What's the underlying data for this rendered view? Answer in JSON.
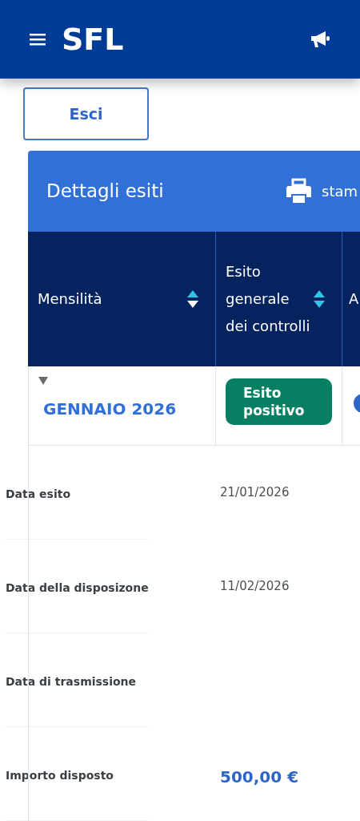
{
  "header": {
    "logo": "SFL"
  },
  "exit_button": "Esci",
  "card": {
    "title": "Dettagli esiti",
    "print_label": "stam"
  },
  "table": {
    "columns": [
      {
        "label": "Mensilità",
        "sorted": true
      },
      {
        "label": "Esito generale dei controlli",
        "sorted": false
      },
      {
        "label": "A"
      }
    ],
    "rows": [
      {
        "month": "GENNAIO 2026",
        "expanded": true,
        "status": {
          "label": "Esito positivo",
          "color": "#087f62"
        }
      }
    ]
  },
  "details": [
    {
      "label": "Data esito",
      "kind": "date",
      "value": "21/01/2026"
    },
    {
      "label": "Data della disposizone",
      "kind": "date",
      "value": "11/02/2026"
    },
    {
      "label": "Data di trasmissione"
    },
    {
      "label": "Importo disposto",
      "kind": "amount",
      "value": "500,00 €"
    }
  ]
}
